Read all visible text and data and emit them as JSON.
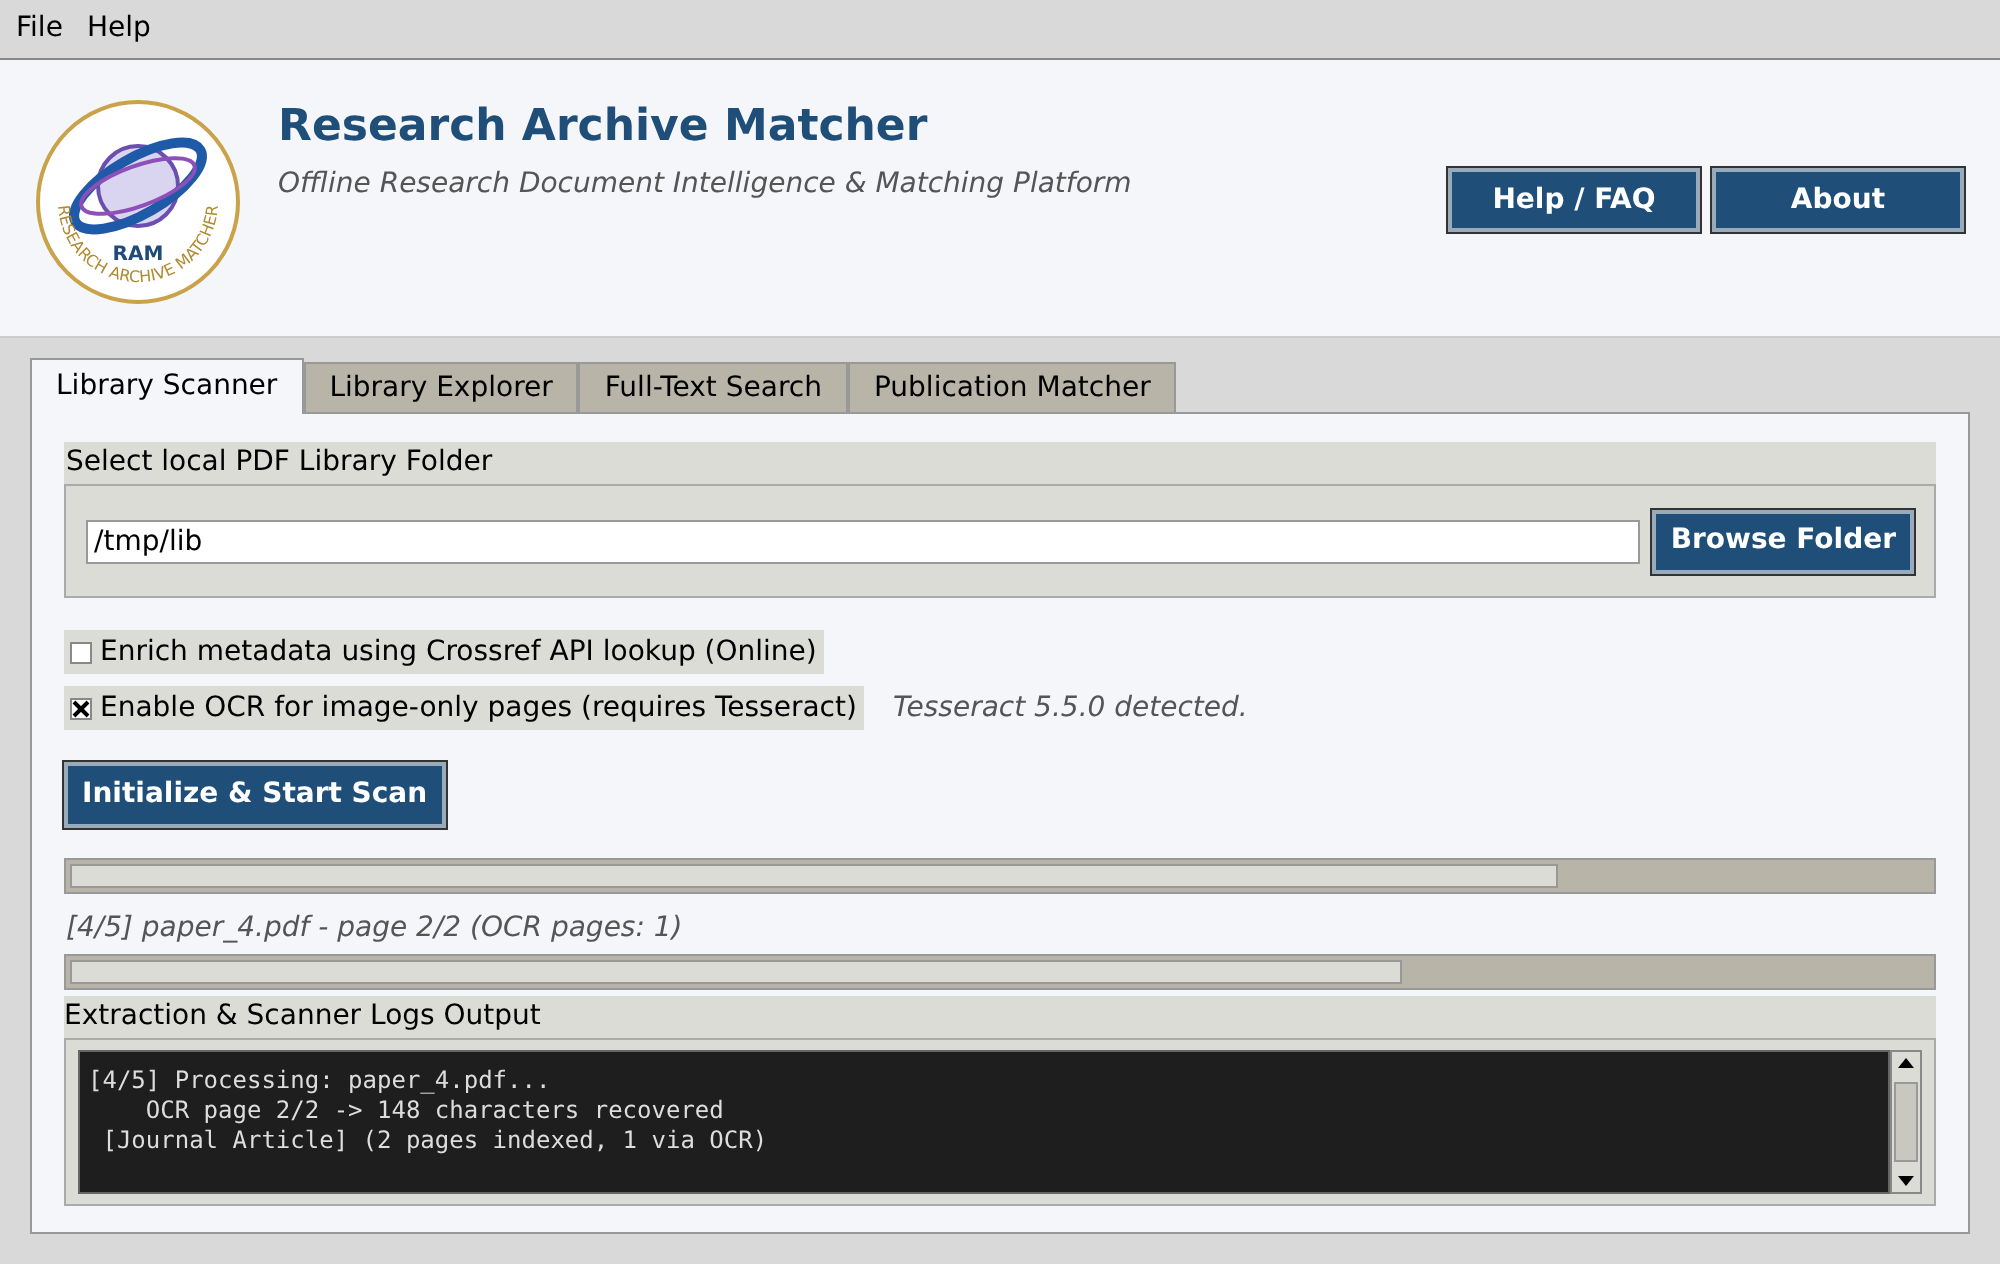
{
  "menu": [
    "File",
    "Help"
  ],
  "header": {
    "logo_text": "RAM",
    "logo_ring_text": "RESEARCH ARCHIVE MATCHER",
    "title": "Research Archive Matcher",
    "subtitle": "Offline Research Document Intelligence & Matching Platform",
    "buttons": [
      "Help / FAQ",
      "About"
    ]
  },
  "tabs": [
    {
      "label": "Library Scanner",
      "selected": true
    },
    {
      "label": "Library Explorer",
      "selected": false
    },
    {
      "label": "Full-Text Search",
      "selected": false
    },
    {
      "label": "Publication Matcher",
      "selected": false
    }
  ],
  "folder": {
    "label": "Select local PDF Library Folder",
    "value": "/tmp/lib",
    "button": "Browse Folder"
  },
  "options": [
    {
      "label": "Enrich metadata using Crossref API lookup (Online)",
      "checked": false
    },
    {
      "label": "Enable OCR for image-only pages (requires Tesseract)",
      "checked": true,
      "note": "Tesseract 5.5.0 detected."
    }
  ],
  "start_button": "Initialize & Start Scan",
  "overall_progress": {
    "level": 0.8
  },
  "status": "[4/5] paper_4.pdf - page 2/2 (OCR pages: 1)",
  "file_progress": {
    "level": 0.716
  },
  "log": {
    "label": "Extraction & Scanner Logs Output",
    "lines": [
      "[4/5] Processing: paper_4.pdf...",
      "    OCR page 2/2 -> 148 characters recovered",
      " [Journal Article] (2 pages indexed, 1 via OCR)"
    ]
  }
}
